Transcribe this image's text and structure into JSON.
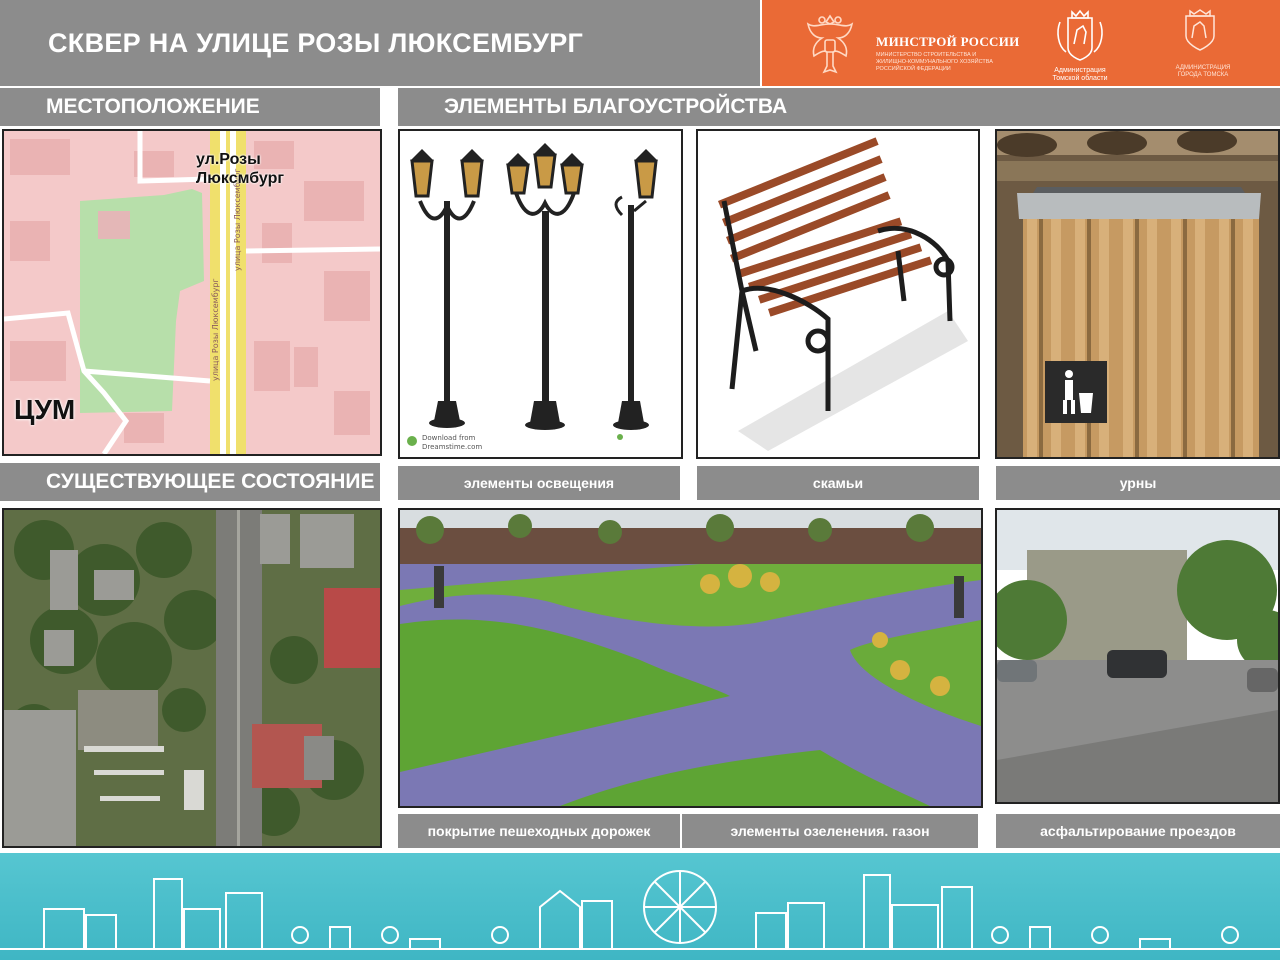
{
  "header": {
    "title": "СКВЕР НА УЛИЦЕ РОЗЫ ЛЮКСЕМБУРГ",
    "ministry_name": "МИНСТРОЙ РОССИИ",
    "ministry_subtitle": "МИНИСТЕРСТВО СТРОИТЕЛЬСТВА И ЖИЛИЩНО-КОММУНАЛЬНОГО ХОЗЯЙСТВА РОССИЙСКОЙ ФЕДЕРАЦИИ",
    "oblast_admin_label": "Администрация Томской области",
    "city_admin_label": "АДМИНИСТРАЦИЯ ГОРОДА ТОМСКА"
  },
  "sections": {
    "location": "МЕСТОПОЛОЖЕНИЕ",
    "elements": "ЭЛЕМЕНТЫ БЛАГОУСТРОЙСТВА",
    "existing": "СУЩЕСТВУЮЩЕЕ СОСТОЯНИЕ"
  },
  "map": {
    "street_label": "ул.Розы Люксмбург",
    "landmark_label": "ЦУМ"
  },
  "captions": {
    "lighting": "элементы освещения",
    "benches": "скамьи",
    "bins": "урны",
    "paths": "покрытие пешеходных дорожек",
    "greenery": "элементы озеленения. газон",
    "asphalt": "асфальтирование проездов"
  },
  "watermark": {
    "download_from": "Download from",
    "site": "Dreamstime.com"
  },
  "colors": {
    "header_gray": "#8c8c8c",
    "header_orange": "#ea6a36",
    "footer_teal": "#4bbfcb"
  }
}
